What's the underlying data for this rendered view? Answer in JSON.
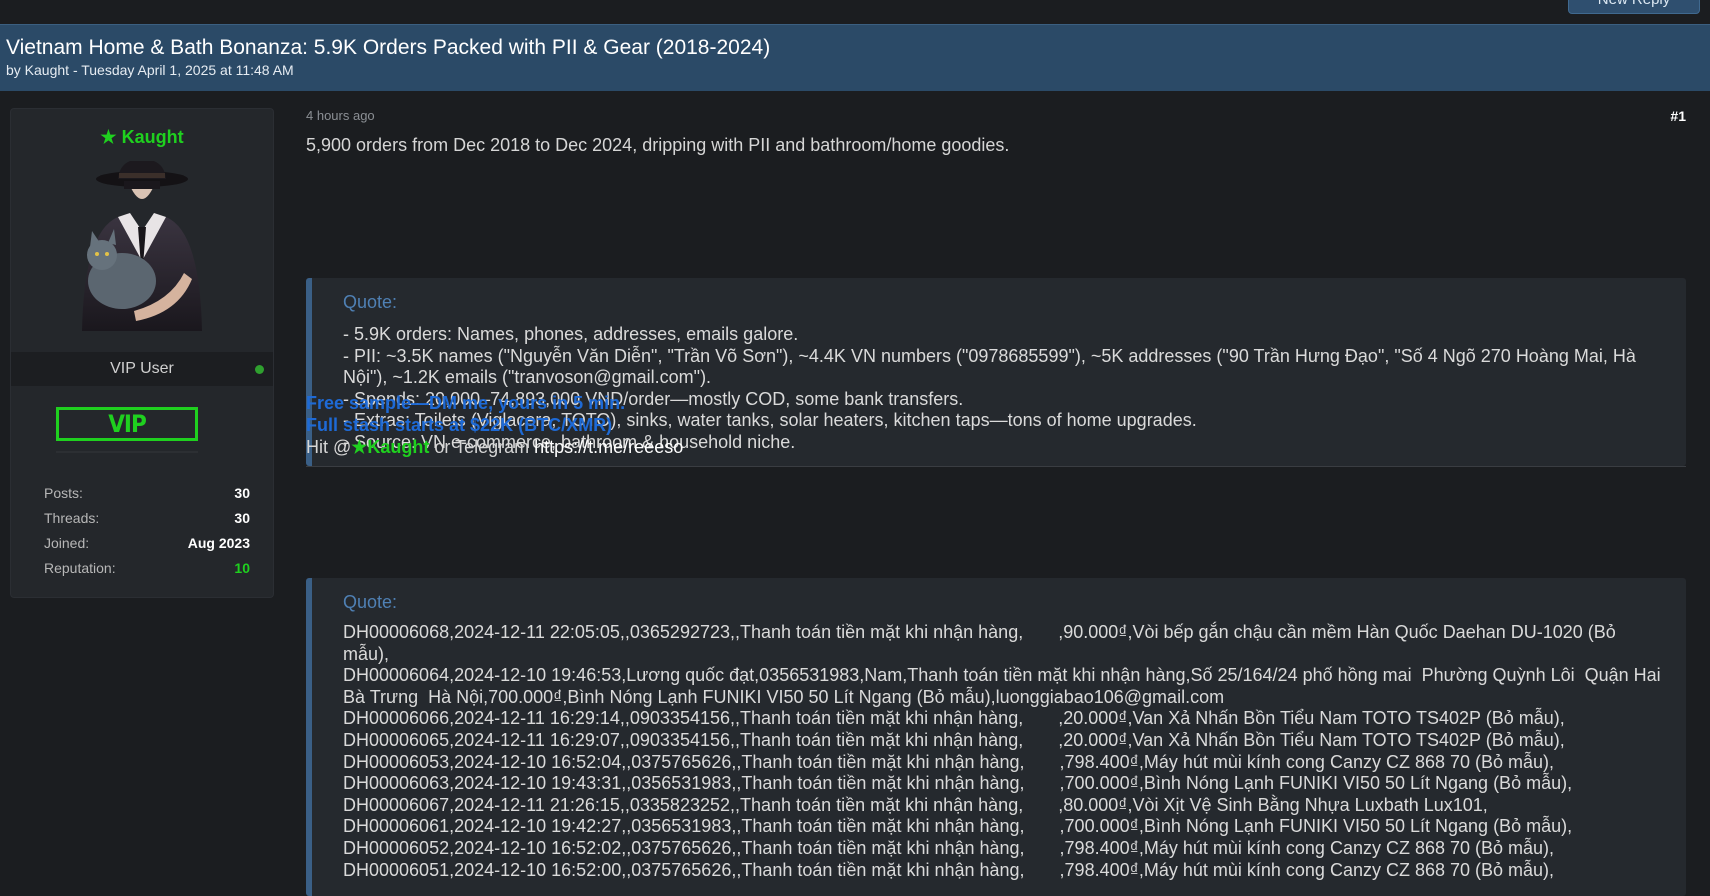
{
  "toolbar": {
    "new_reply_label": "New Reply"
  },
  "thread": {
    "title": "Vietnam Home & Bath Bonanza: 5.9K Orders Packed with PII & Gear (2018-2024)",
    "meta": "by Kaught - Tuesday April 1, 2025 at 11:48 AM"
  },
  "user": {
    "star": "★",
    "name": "Kaught",
    "role": "VIP User",
    "badge": "VIP",
    "stats": [
      {
        "label": "Posts:",
        "value": "30"
      },
      {
        "label": "Threads:",
        "value": "30"
      },
      {
        "label": "Joined:",
        "value": "Aug 2023"
      },
      {
        "label": "Reputation:",
        "value": "10"
      }
    ]
  },
  "post": {
    "time": "4 hours ago",
    "number": "#1",
    "intro": "5,900 orders from Dec 2018 to Dec 2024, dripping with PII and bathroom/home goodies.",
    "quote1": {
      "label": "Quote:",
      "lines": [
        "- 5.9K orders: Names, phones, addresses, emails galore.",
        "- PII: ~3.5K names (\"Nguyễn Văn Diễn\", \"Trần Võ Sơn\"), ~4.4K VN numbers (\"0978685599\"), ~5K addresses (\"90 Trần Hưng Đạo\", \"Số 4 Ngõ 270 Hoàng Mai, Hà Nội\"), ~1.2K emails (\"tranvoson@gmail.com\").",
        "- Spends: 20,000–74,893,000 VND/order—mostly COD, some bank transfers.",
        "- Extras: Toilets (Viglacera, TOTO), sinks, water tanks, solar heaters, kitchen taps—tons of home upgrades.",
        "- Source: VN e-commerce, bathroom & household niche."
      ]
    },
    "promo": {
      "line1": "Free sample—DM me, yours in 5 min.",
      "line2": "Full stash starts at $22K (BTC/XMR)",
      "hit_prefix": "Hit @",
      "hit_star": "★",
      "hit_name": "Kaught",
      "hit_middle": " or Telegram ",
      "telegram": "https://t.me/reeeso"
    },
    "quote2": {
      "label": "Quote:",
      "lines": [
        "DH00006068,2024-12-11 22:05:05,,0365292723,,Thanh toán tiền mặt khi nhận hàng,       ,90.000₫,Vòi bếp gắn chậu cần mềm Hàn Quốc Daehan DU-1020 (Bỏ mẫu),",
        "DH00006064,2024-12-10 19:46:53,Lương quốc đạt,0356531983,Nam,Thanh toán tiền mặt khi nhận hàng,Số 25/164/24 phố hồng mai  Phường Quỳnh Lôi  Quận Hai Bà Trưng  Hà Nội,700.000₫,Bình Nóng Lạnh FUNIKI VI50 50 Lít Ngang (Bỏ mẫu),luonggiabao106@gmail.com",
        "DH00006066,2024-12-11 16:29:14,,0903354156,,Thanh toán tiền mặt khi nhận hàng,       ,20.000₫,Van Xả Nhấn Bồn Tiểu Nam TOTO TS402P (Bỏ mẫu),",
        "DH00006065,2024-12-11 16:29:07,,0903354156,,Thanh toán tiền mặt khi nhận hàng,       ,20.000₫,Van Xả Nhấn Bồn Tiểu Nam TOTO TS402P (Bỏ mẫu),",
        "DH00006053,2024-12-10 16:52:04,,0375765626,,Thanh toán tiền mặt khi nhận hàng,       ,798.400₫,Máy hút mùi kính cong Canzy CZ 868 70 (Bỏ mẫu),",
        "DH00006063,2024-12-10 19:43:31,,0356531983,,Thanh toán tiền mặt khi nhận hàng,       ,700.000₫,Bình Nóng Lạnh FUNIKI VI50 50 Lít Ngang (Bỏ mẫu),",
        "DH00006067,2024-12-11 21:26:15,,0335823252,,Thanh toán tiền mặt khi nhận hàng,       ,80.000₫,Vòi Xịt Vệ Sinh Bằng Nhựa Luxbath Lux101,",
        "DH00006061,2024-12-10 19:42:27,,0356531983,,Thanh toán tiền mặt khi nhận hàng,       ,700.000₫,Bình Nóng Lạnh FUNIKI VI50 50 Lít Ngang (Bỏ mẫu),",
        "DH00006052,2024-12-10 16:52:02,,0375765626,,Thanh toán tiền mặt khi nhận hàng,       ,798.400₫,Máy hút mùi kính cong Canzy CZ 868 70 (Bỏ mẫu),",
        "DH00006051,2024-12-10 16:52:00,,0375765626,,Thanh toán tiền mặt khi nhận hàng,       ,798.400₫,Máy hút mùi kính cong Canzy CZ 868 70 (Bỏ mẫu),"
      ]
    }
  },
  "colors": {
    "header_bg": "#2b4a67",
    "username_green": "#1fd01f",
    "quote_accent": "#3a5f86",
    "promo_blue": "#1e6ad6"
  }
}
